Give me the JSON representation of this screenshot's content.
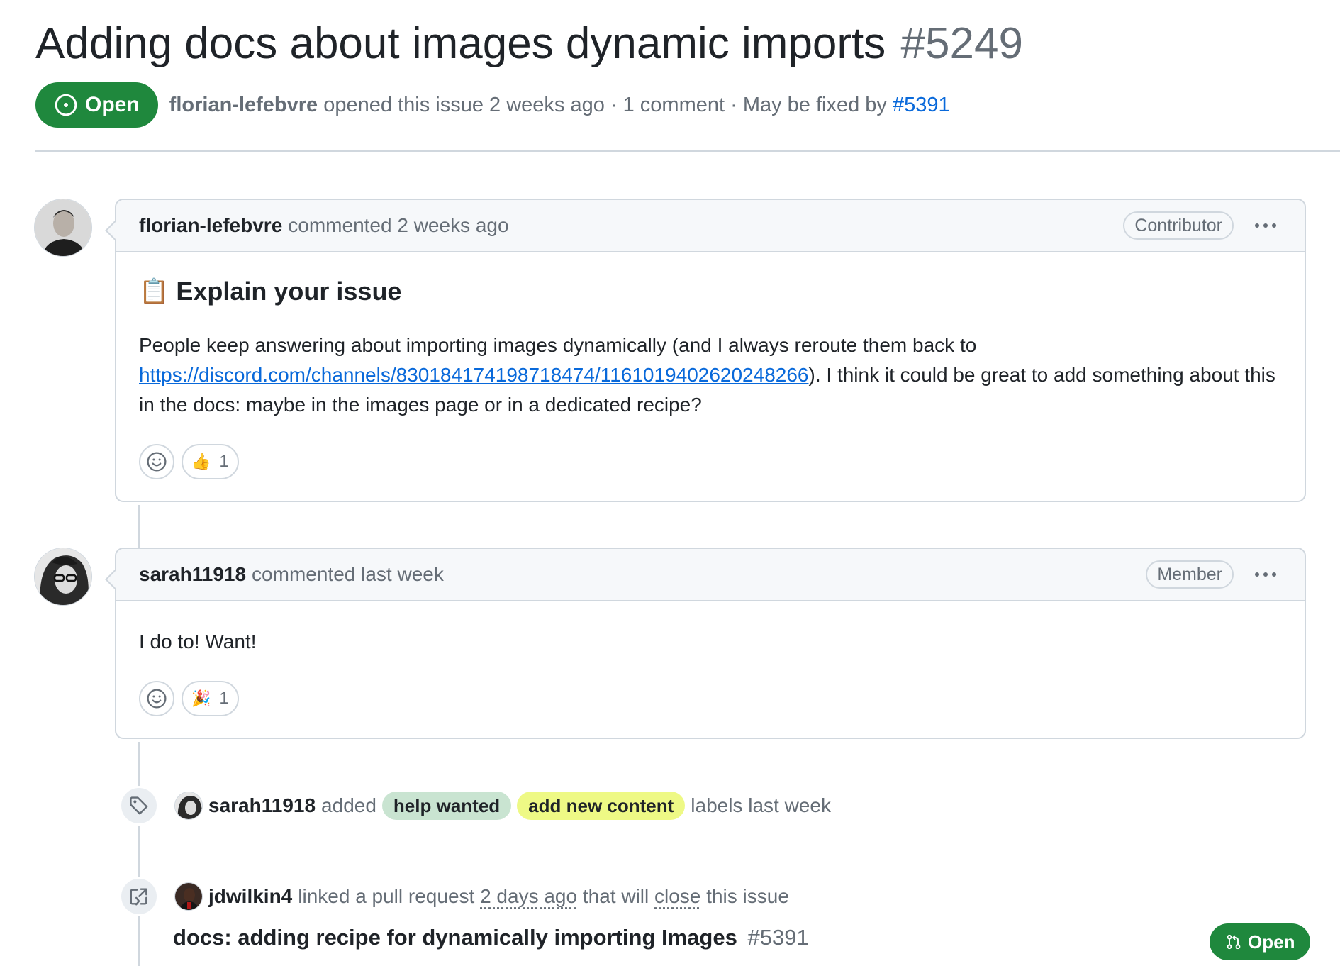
{
  "issue": {
    "title": "Adding docs about images dynamic imports",
    "number": "#5249",
    "state": "Open",
    "author": "florian-lefebvre",
    "meta_opened": "opened this issue 2 weeks ago · 1 comment · May be fixed by",
    "fixed_by": "#5391"
  },
  "comments": [
    {
      "author": "florian-lefebvre",
      "time": "commented 2 weeks ago",
      "role": "Contributor",
      "heading_emoji": "📋",
      "heading": "Explain your issue",
      "body_before": "People keep answering about importing images dynamically (and I always reroute them back to ",
      "body_link": "https://discord.com/channels/830184174198718474/1161019402620248266",
      "body_after": "). I think it could be great to add something about this in the docs: maybe in the images page or in a dedicated recipe?",
      "reaction_emoji": "👍",
      "reaction_count": "1"
    },
    {
      "author": "sarah11918",
      "time": "commented last week",
      "role": "Member",
      "body": "I do to! Want!",
      "reaction_emoji": "🎉",
      "reaction_count": "1"
    }
  ],
  "events": {
    "labeled": {
      "author": "sarah11918",
      "action": "added",
      "labels": [
        {
          "name": "help wanted",
          "color": "#c9e4d1"
        },
        {
          "name": "add new content",
          "color": "#eef985"
        }
      ],
      "suffix": "labels last week"
    },
    "linked": {
      "author": "jdwilkin4",
      "text1": "linked a pull request",
      "time": "2 days ago",
      "text2": "that will",
      "close": "close",
      "text3": "this issue",
      "pr_title": "docs: adding recipe for dynamically importing Images",
      "pr_number": "#5391",
      "pr_state": "Open"
    }
  },
  "colors": {
    "open_green": "#1f883d",
    "link_blue": "#0969da",
    "muted": "#656d76",
    "border": "#d0d7de"
  },
  "icons": [
    "issue-opened-icon",
    "kebab-horizontal-icon",
    "smiley-icon",
    "tag-icon",
    "cross-reference-icon",
    "git-pull-request-icon"
  ]
}
